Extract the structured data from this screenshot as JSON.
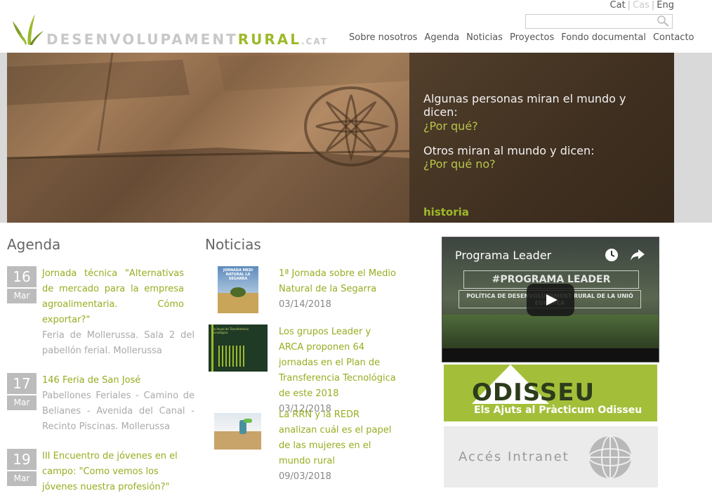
{
  "header": {
    "logo": {
      "part1": "DESENVOLUPAMENT",
      "part2": "RURAL",
      "part3": ".CAT"
    },
    "languages": [
      {
        "label": "Cat",
        "active": false
      },
      {
        "label": "Cas",
        "active": true
      },
      {
        "label": "Eng",
        "active": false
      }
    ],
    "search": {
      "value": "",
      "icon": "search-icon"
    },
    "nav": [
      "Sobre nosotros",
      "Agenda",
      "Noticias",
      "Proyectos",
      "Fondo documental",
      "Contacto"
    ]
  },
  "hero": {
    "line1": "Algunas personas miran el mundo y dicen:",
    "line2": "¿Por qué?",
    "line3": "Otros miran al mundo y dicen:",
    "line4": "¿Por qué no?",
    "link": "historia"
  },
  "agenda": {
    "title": "Agenda",
    "events": [
      {
        "day": "16",
        "month": "Mar",
        "title": "Jornada técnica \"Alternativas de mercado para la empresa agroalimentaria. Cómo exportar?\"",
        "desc": "Feria de Mollerussa. Sala 2 del pabellón ferial. Mollerussa"
      },
      {
        "day": "17",
        "month": "Mar",
        "title": "146 Feria de San José",
        "desc": "Pabellones Feriales - Camino de Belianes - Avenida del Canal - Recinto Piscinas. Mollerussa"
      },
      {
        "day": "19",
        "month": "Mar",
        "title": "III Encuentro de jóvenes en el campo: \"Como vemos los jóvenes nuestra profesión?\"",
        "desc": ""
      }
    ]
  },
  "news": {
    "title": "Noticias",
    "items": [
      {
        "title": "1ª Jornada sobre el Medio Natural de la Segarra",
        "date": "03/14/2018",
        "thumb_text": "JORNADA MEDI NATURAL LA SEGARRA"
      },
      {
        "title": "Los grupos Leader y ARCA proponen 64 jornadas en el Plan de Transferencia Tecnológica de este 2018",
        "date": "03/12/2018",
        "thumb_text": "Pla Anual de Transferència Tecnològica"
      },
      {
        "title": "La RRN y la REDR analizan cuál es el papel de las mujeres en el mundo rural",
        "date": "09/03/2018",
        "thumb_text": ""
      }
    ]
  },
  "sidebar": {
    "video": {
      "title": "Programa Leader",
      "overlay1": "#PROGRAMA LEADER",
      "overlay2": "POLÍTICA DE DESENVOLUPAMENT RURAL DE LA UNIÓ EUROPEA"
    },
    "odisseu": {
      "title": "ODISSEU",
      "subtitle": "Els Ajuts al Pràcticum Odisseu"
    },
    "intranet": {
      "label": "Accés Intranet"
    }
  },
  "colors": {
    "accent": "#9cba2a",
    "grey_box": "#bcbcbc"
  }
}
